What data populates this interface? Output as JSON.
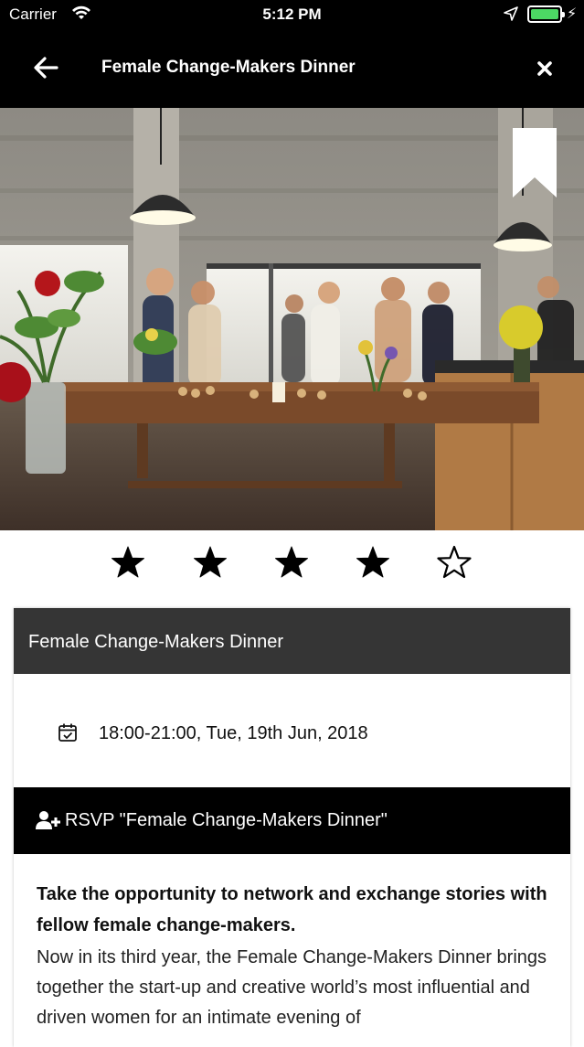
{
  "status_bar": {
    "carrier": "Carrier",
    "time": "5:12 PM",
    "battery_level": 1.0,
    "battery_color": "#4cd964"
  },
  "nav": {
    "back_icon": "arrow-left-icon",
    "title": "Female Change-Makers Dinner",
    "close_icon": "close-icon"
  },
  "hero": {
    "bookmark_icon": "bookmark-icon"
  },
  "rating": {
    "value": 4,
    "max": 5
  },
  "event": {
    "title": "Female Change-Makers Dinner",
    "datetime": "18:00-21:00, Tue, 19th Jun, 2018",
    "rsvp_label": "RSVP \"Female Change-Makers Dinner\"",
    "description_lead": "Take the opportunity to network and exchange stories with fellow female change-makers.",
    "description_body": "Now in its third year, the Female Change-Makers Dinner brings together the start-up and creative world’s most influential and driven women for an intimate evening of"
  },
  "colors": {
    "nav_bg": "#000000",
    "card_header_bg": "#353535",
    "rsvp_bg": "#000000"
  }
}
